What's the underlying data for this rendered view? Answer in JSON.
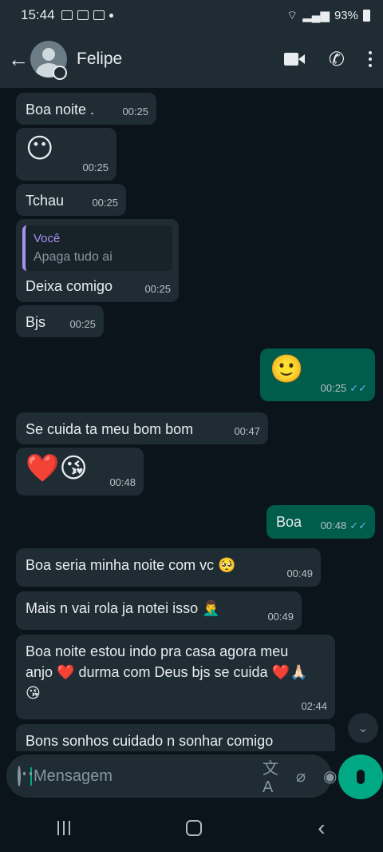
{
  "status_bar": {
    "time": "15:44",
    "battery": "93%"
  },
  "header": {
    "contact_name": "Felipe"
  },
  "messages": [
    {
      "text": "Boa noite .",
      "time": "00:25"
    },
    {
      "text": "😶",
      "time": "00:25"
    },
    {
      "text": "Tchau",
      "time": "00:25"
    },
    {
      "quote_author": "Você",
      "quote_text": "Apaga tudo ai",
      "text": "Deixa comigo",
      "time": "00:25"
    },
    {
      "text": "Bjs",
      "time": "00:25"
    },
    {
      "text": "🙂",
      "time": "00:25",
      "ticks": "✓✓"
    },
    {
      "text": "Se cuida ta meu bom bom",
      "time": "00:47"
    },
    {
      "text": "❤️😘",
      "time": "00:48"
    },
    {
      "text": "Boa",
      "time": "00:48",
      "ticks": "✓✓"
    },
    {
      "text": "Boa seria minha noite com vc 🥺",
      "time": "00:49"
    },
    {
      "text": "Mais n vai rola ja notei isso 🤦‍♂️",
      "time": "00:49"
    },
    {
      "text": "Boa noite estou indo pra casa agora meu anjo ❤️ durma com Deus bjs se cuida ❤️🙏🏻😘",
      "time": "02:44"
    },
    {
      "text": "Bons sonhos cuidado n sonhar comigo"
    }
  ],
  "composer": {
    "placeholder": "Mensagem"
  },
  "colors": {
    "accent": "#00a884",
    "outgoing_bubble": "#005c4b",
    "incoming_bubble": "#1f2c34"
  }
}
